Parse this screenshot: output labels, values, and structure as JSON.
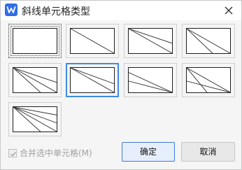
{
  "window": {
    "title": "斜线单元格类型",
    "app_icon_letter": "W",
    "accent_color": "#2f6ee7"
  },
  "tiles": [
    {
      "id": "none",
      "selected": false,
      "focused": true
    },
    {
      "id": "diag-1",
      "selected": false
    },
    {
      "id": "diag-2a",
      "selected": false
    },
    {
      "id": "diag-2b",
      "selected": false
    },
    {
      "id": "diag-2c",
      "selected": false
    },
    {
      "id": "diag-2d",
      "selected": true
    },
    {
      "id": "diag-2e",
      "selected": false
    },
    {
      "id": "diag-2f",
      "selected": false
    },
    {
      "id": "diag-3",
      "selected": false
    }
  ],
  "merge_checkbox": {
    "label": "合并选中单元格(M)",
    "checked": true,
    "disabled": true
  },
  "buttons": {
    "ok": "确定",
    "cancel": "取消"
  }
}
